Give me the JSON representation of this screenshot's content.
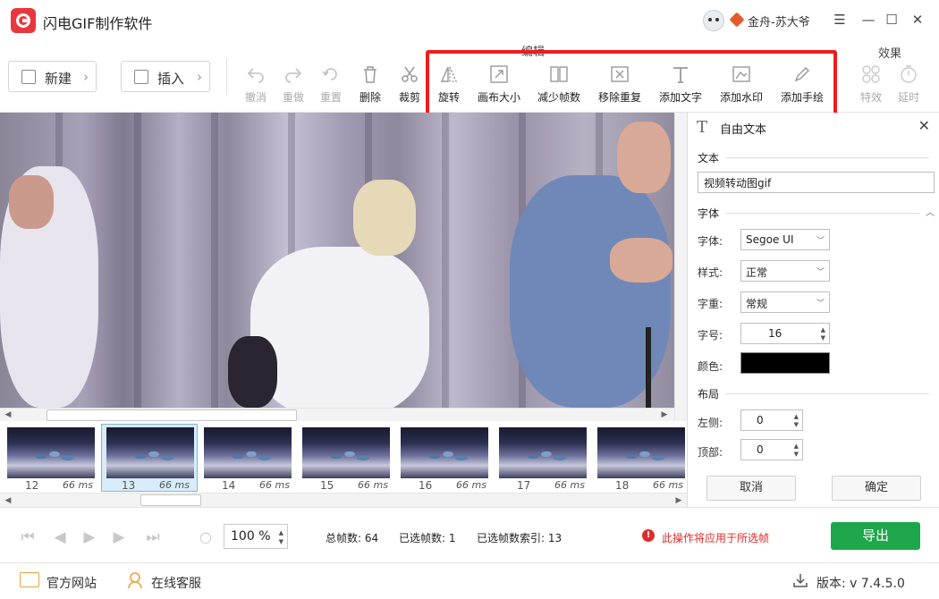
{
  "app": {
    "title": "闪电GIF制作软件",
    "user": "金舟-苏大爷"
  },
  "window_controls": {
    "menu": "☰",
    "minimize": "—",
    "maximize": "☐",
    "close": "✕"
  },
  "toolbar": {
    "new_label": "新建",
    "insert_label": "插入",
    "edit_group": "编辑",
    "effect_group": "效果",
    "undo": "撤消",
    "redo": "重做",
    "reset": "重置",
    "delete": "删除",
    "crop": "裁剪",
    "rotate": "旋转",
    "canvas_size": "画布大小",
    "reduce_frames": "减少帧数",
    "remove_duplicates": "移除重复",
    "add_text": "添加文字",
    "add_watermark": "添加水印",
    "add_drawing": "添加手绘",
    "effects": "特效",
    "delay": "延时"
  },
  "frames": [
    {
      "num": "12",
      "ms": "66 ms"
    },
    {
      "num": "13",
      "ms": "66 ms"
    },
    {
      "num": "14",
      "ms": "66 ms"
    },
    {
      "num": "15",
      "ms": "66 ms"
    },
    {
      "num": "16",
      "ms": "66 ms"
    },
    {
      "num": "17",
      "ms": "66 ms"
    },
    {
      "num": "18",
      "ms": "66 ms"
    }
  ],
  "panel": {
    "title": "自由文本",
    "text_section": "文本",
    "text_value": "视频转动图gif",
    "font_section": "字体",
    "font_label": "字体:",
    "font_value": "Segoe UI",
    "style_label": "样式:",
    "style_value": "正常",
    "weight_label": "字重:",
    "weight_value": "常规",
    "size_label": "字号:",
    "size_value": "16",
    "color_label": "颜色:",
    "color_value": "#000000",
    "layout_section": "布局",
    "left_label": "左侧:",
    "left_value": "0",
    "top_label": "顶部:",
    "top_value": "0",
    "cancel": "取消",
    "confirm": "确定"
  },
  "status": {
    "zoom_value": "100",
    "zoom_unit": "%",
    "total_frames": "总帧数: 64",
    "selected_frames": "已选帧数: 1",
    "selected_index": "已选帧数索引: 13",
    "warning": "此操作将应用于所选帧",
    "export": "导出"
  },
  "footer": {
    "website": "官方网站",
    "support": "在线客服",
    "version": "版本: v 7.4.5.0"
  }
}
